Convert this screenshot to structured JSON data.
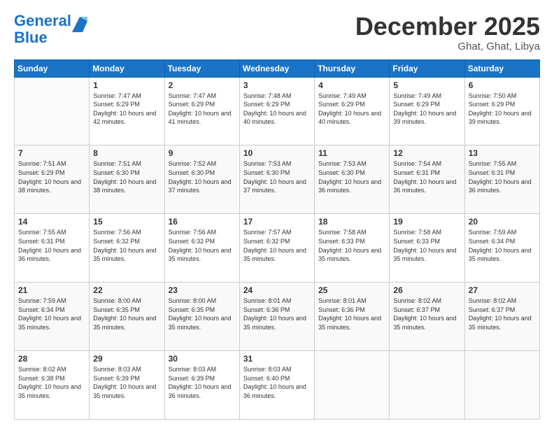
{
  "logo": {
    "line1": "General",
    "line2": "Blue"
  },
  "title": "December 2025",
  "location": "Ghat, Ghat, Libya",
  "days_header": [
    "Sunday",
    "Monday",
    "Tuesday",
    "Wednesday",
    "Thursday",
    "Friday",
    "Saturday"
  ],
  "weeks": [
    [
      {
        "day": "",
        "info": ""
      },
      {
        "day": "1",
        "info": "Sunrise: 7:47 AM\nSunset: 6:29 PM\nDaylight: 10 hours and 42 minutes."
      },
      {
        "day": "2",
        "info": "Sunrise: 7:47 AM\nSunset: 6:29 PM\nDaylight: 10 hours and 41 minutes."
      },
      {
        "day": "3",
        "info": "Sunrise: 7:48 AM\nSunset: 6:29 PM\nDaylight: 10 hours and 40 minutes."
      },
      {
        "day": "4",
        "info": "Sunrise: 7:49 AM\nSunset: 6:29 PM\nDaylight: 10 hours and 40 minutes."
      },
      {
        "day": "5",
        "info": "Sunrise: 7:49 AM\nSunset: 6:29 PM\nDaylight: 10 hours and 39 minutes."
      },
      {
        "day": "6",
        "info": "Sunrise: 7:50 AM\nSunset: 6:29 PM\nDaylight: 10 hours and 39 minutes."
      }
    ],
    [
      {
        "day": "7",
        "info": "Sunrise: 7:51 AM\nSunset: 6:29 PM\nDaylight: 10 hours and 38 minutes."
      },
      {
        "day": "8",
        "info": "Sunrise: 7:51 AM\nSunset: 6:30 PM\nDaylight: 10 hours and 38 minutes."
      },
      {
        "day": "9",
        "info": "Sunrise: 7:52 AM\nSunset: 6:30 PM\nDaylight: 10 hours and 37 minutes."
      },
      {
        "day": "10",
        "info": "Sunrise: 7:53 AM\nSunset: 6:30 PM\nDaylight: 10 hours and 37 minutes."
      },
      {
        "day": "11",
        "info": "Sunrise: 7:53 AM\nSunset: 6:30 PM\nDaylight: 10 hours and 36 minutes."
      },
      {
        "day": "12",
        "info": "Sunrise: 7:54 AM\nSunset: 6:31 PM\nDaylight: 10 hours and 36 minutes."
      },
      {
        "day": "13",
        "info": "Sunrise: 7:55 AM\nSunset: 6:31 PM\nDaylight: 10 hours and 36 minutes."
      }
    ],
    [
      {
        "day": "14",
        "info": "Sunrise: 7:55 AM\nSunset: 6:31 PM\nDaylight: 10 hours and 36 minutes."
      },
      {
        "day": "15",
        "info": "Sunrise: 7:56 AM\nSunset: 6:32 PM\nDaylight: 10 hours and 35 minutes."
      },
      {
        "day": "16",
        "info": "Sunrise: 7:56 AM\nSunset: 6:32 PM\nDaylight: 10 hours and 35 minutes."
      },
      {
        "day": "17",
        "info": "Sunrise: 7:57 AM\nSunset: 6:32 PM\nDaylight: 10 hours and 35 minutes."
      },
      {
        "day": "18",
        "info": "Sunrise: 7:58 AM\nSunset: 6:33 PM\nDaylight: 10 hours and 35 minutes."
      },
      {
        "day": "19",
        "info": "Sunrise: 7:58 AM\nSunset: 6:33 PM\nDaylight: 10 hours and 35 minutes."
      },
      {
        "day": "20",
        "info": "Sunrise: 7:59 AM\nSunset: 6:34 PM\nDaylight: 10 hours and 35 minutes."
      }
    ],
    [
      {
        "day": "21",
        "info": "Sunrise: 7:59 AM\nSunset: 6:34 PM\nDaylight: 10 hours and 35 minutes."
      },
      {
        "day": "22",
        "info": "Sunrise: 8:00 AM\nSunset: 6:35 PM\nDaylight: 10 hours and 35 minutes."
      },
      {
        "day": "23",
        "info": "Sunrise: 8:00 AM\nSunset: 6:35 PM\nDaylight: 10 hours and 35 minutes."
      },
      {
        "day": "24",
        "info": "Sunrise: 8:01 AM\nSunset: 6:36 PM\nDaylight: 10 hours and 35 minutes."
      },
      {
        "day": "25",
        "info": "Sunrise: 8:01 AM\nSunset: 6:36 PM\nDaylight: 10 hours and 35 minutes."
      },
      {
        "day": "26",
        "info": "Sunrise: 8:02 AM\nSunset: 6:37 PM\nDaylight: 10 hours and 35 minutes."
      },
      {
        "day": "27",
        "info": "Sunrise: 8:02 AM\nSunset: 6:37 PM\nDaylight: 10 hours and 35 minutes."
      }
    ],
    [
      {
        "day": "28",
        "info": "Sunrise: 8:02 AM\nSunset: 6:38 PM\nDaylight: 10 hours and 35 minutes."
      },
      {
        "day": "29",
        "info": "Sunrise: 8:03 AM\nSunset: 6:39 PM\nDaylight: 10 hours and 35 minutes."
      },
      {
        "day": "30",
        "info": "Sunrise: 8:03 AM\nSunset: 6:39 PM\nDaylight: 10 hours and 36 minutes."
      },
      {
        "day": "31",
        "info": "Sunrise: 8:03 AM\nSunset: 6:40 PM\nDaylight: 10 hours and 36 minutes."
      },
      {
        "day": "",
        "info": ""
      },
      {
        "day": "",
        "info": ""
      },
      {
        "day": "",
        "info": ""
      }
    ]
  ]
}
